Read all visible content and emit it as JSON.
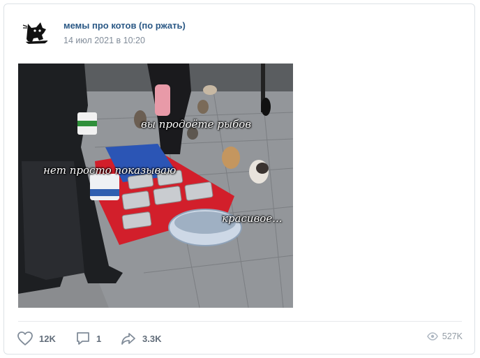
{
  "post": {
    "author": "мемы про котов (по ржать)",
    "date": "14 июл 2021 в 10:20",
    "image": {
      "captions": [
        "вы продоёте рыбов",
        "нет просто показываю",
        "красивое..."
      ]
    },
    "actions": {
      "likes": "12K",
      "comments": "1",
      "shares": "3.3K"
    },
    "views": "527K"
  },
  "colors": {
    "author_link": "#2a5885",
    "secondary_text": "#818c99",
    "action_text": "#626d7a",
    "border": "#dce1e6"
  }
}
